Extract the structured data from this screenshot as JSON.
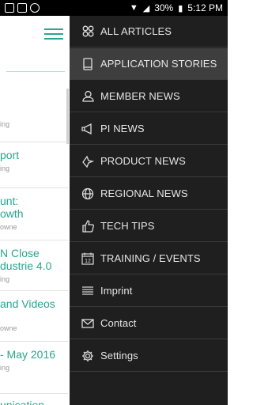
{
  "statusbar": {
    "battery": "30%",
    "time": "5:12 PM"
  },
  "background_list": {
    "items": [
      {
        "title": "port",
        "subtitle": "ing"
      },
      {
        "title": "unt:",
        "title2": "owth",
        "subtitle": "owne"
      },
      {
        "title": "N Close",
        "title2": "dustrie 4.0",
        "subtitle": "ing"
      },
      {
        "title": "and Videos",
        "subtitle": "owne"
      },
      {
        "title": "- May 2016",
        "subtitle": "ing"
      },
      {
        "title": "unication"
      }
    ],
    "first_subtitle": "ing"
  },
  "drawer": {
    "items": [
      {
        "label": "ALL ARTICLES",
        "icon": "grid-icon"
      },
      {
        "label": "APPLICATION STORIES",
        "icon": "tablet-icon"
      },
      {
        "label": "MEMBER NEWS",
        "icon": "person-icon"
      },
      {
        "label": "PI NEWS",
        "icon": "megaphone-icon"
      },
      {
        "label": "PRODUCT NEWS",
        "icon": "sparkle-icon"
      },
      {
        "label": "REGIONAL NEWS",
        "icon": "globe-icon"
      },
      {
        "label": "TECH TIPS",
        "icon": "thumbs-up-icon"
      },
      {
        "label": "TRAINING / EVENTS",
        "icon": "calendar-icon"
      },
      {
        "label": "Imprint",
        "icon": "lines-icon"
      },
      {
        "label": "Contact",
        "icon": "envelope-icon"
      },
      {
        "label": "Settings",
        "icon": "gear-icon"
      }
    ],
    "calendar_day": "12"
  },
  "colors": {
    "accent": "#2aa58e",
    "drawer_bg": "#1f1f1f"
  }
}
